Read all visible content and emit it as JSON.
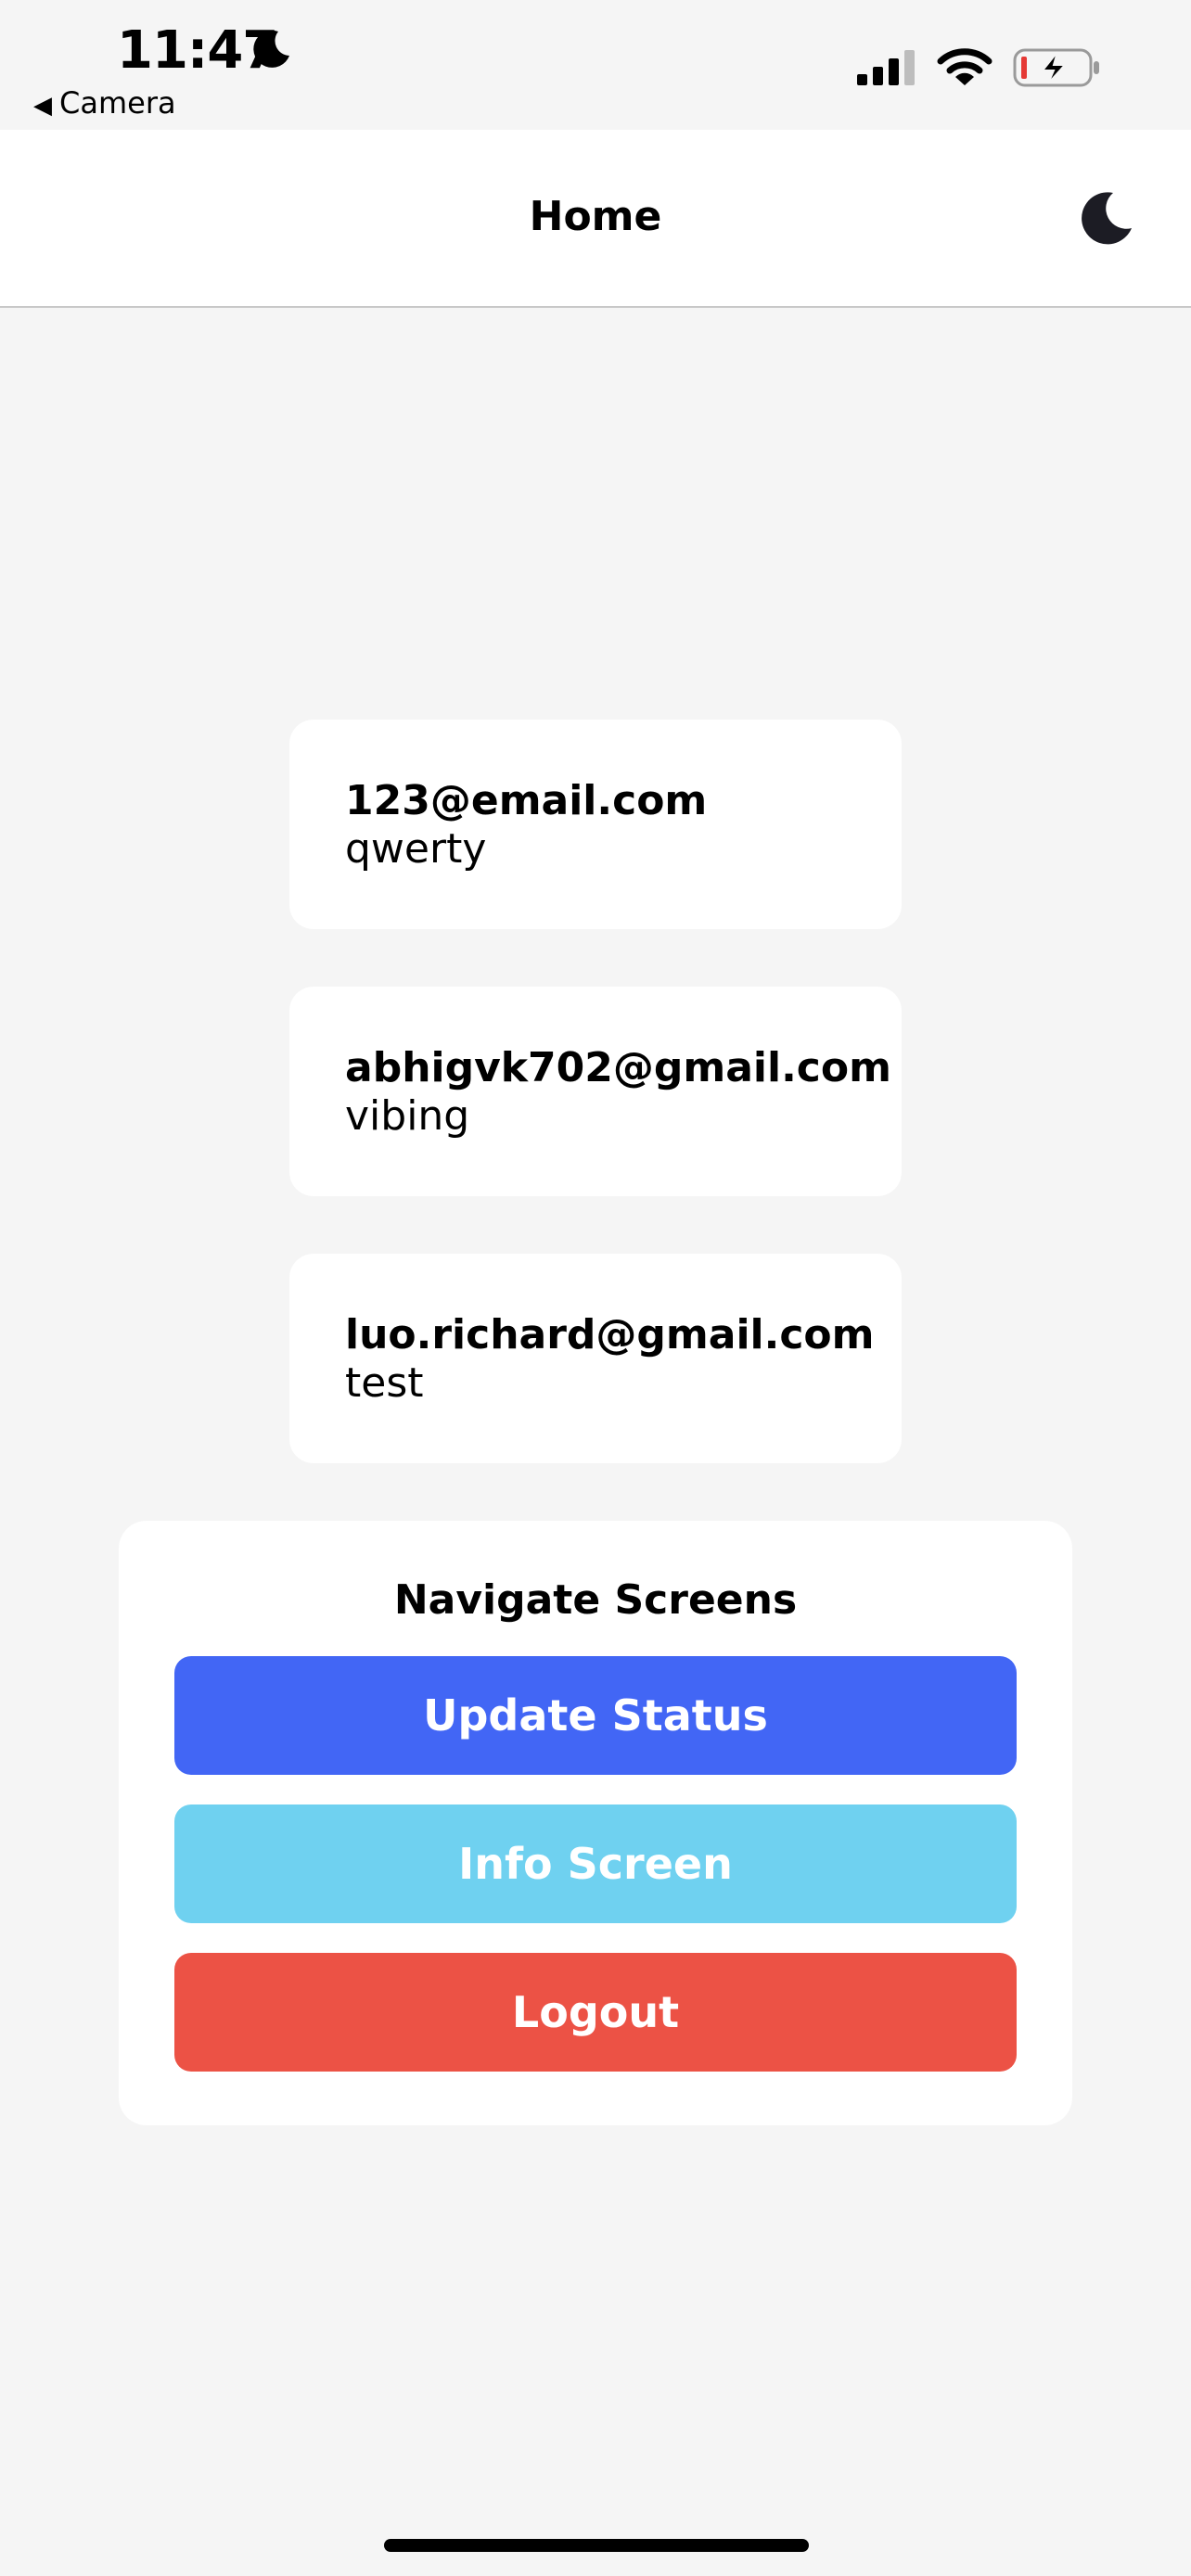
{
  "status_bar": {
    "time": "11:47",
    "back_label": "Camera"
  },
  "header": {
    "title": "Home"
  },
  "users": [
    {
      "email": "123@email.com",
      "status": "qwerty"
    },
    {
      "email": "abhigvk702@gmail.com",
      "status": "vibing"
    },
    {
      "email": "luo.richard@gmail.com",
      "status": "test"
    }
  ],
  "navigate": {
    "title": "Navigate Screens",
    "update_status_label": "Update Status",
    "info_screen_label": "Info Screen",
    "logout_label": "Logout"
  },
  "colors": {
    "update_status": "#4266f5",
    "info_screen": "#6fd1f0",
    "logout": "#ec5245",
    "background": "#f5f5f5"
  },
  "icons": {
    "status_focus": "moon-icon",
    "theme_toggle": "moon-icon",
    "signal": "cellular-signal-icon",
    "wifi": "wifi-icon",
    "battery": "battery-charging-icon"
  }
}
